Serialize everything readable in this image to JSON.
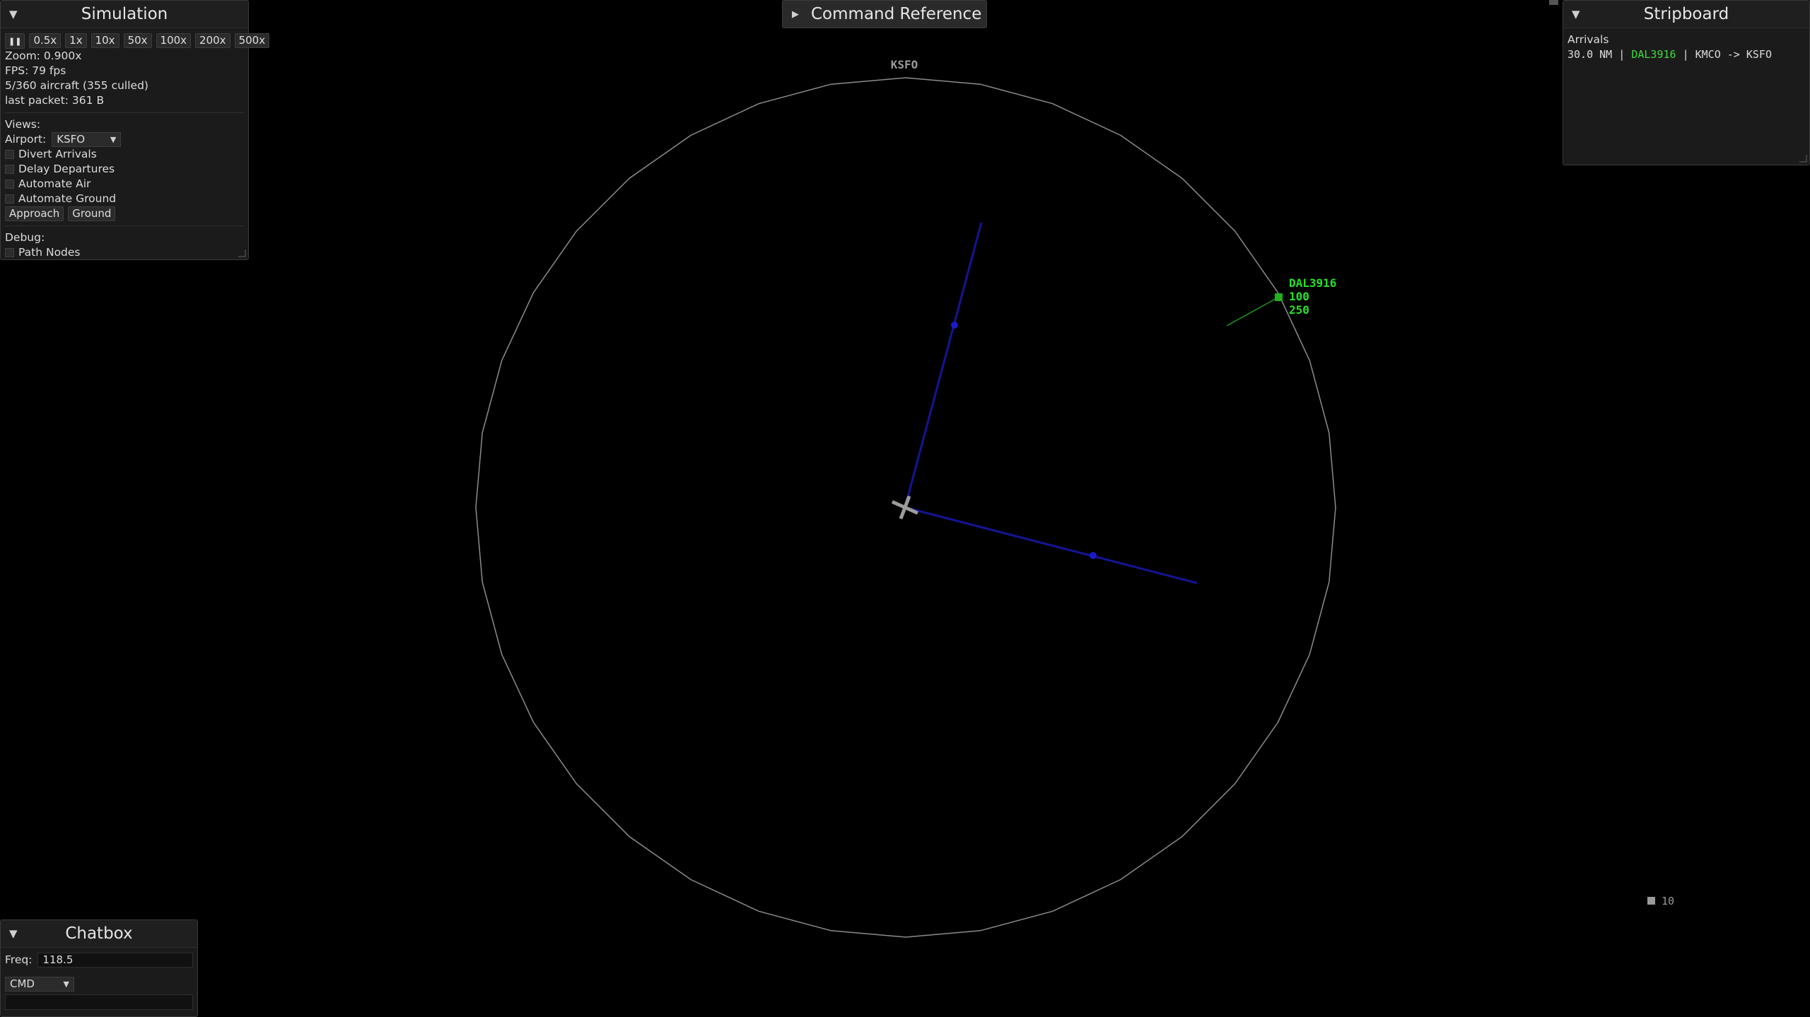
{
  "simulation": {
    "title": "Simulation",
    "speeds": [
      "0.5x",
      "1x",
      "10x",
      "50x",
      "100x",
      "200x",
      "500x"
    ],
    "zoom": "Zoom: 0.900x",
    "fps": "FPS: 79 fps",
    "aircraft": "5/360 aircraft (355 culled)",
    "last_packet": "last packet: 361 B",
    "views_label": "Views:",
    "airport_label": "Airport:",
    "airport_value": "KSFO",
    "checks": [
      "Divert Arrivals",
      "Delay Departures",
      "Automate Air",
      "Automate Ground"
    ],
    "approach_button": "Approach",
    "ground_button": "Ground",
    "debug_label": "Debug:",
    "path_nodes": "Path Nodes"
  },
  "command_reference": {
    "label": "Command Reference"
  },
  "stripboard": {
    "title": "Stripboard",
    "section": "Arrivals",
    "strip": {
      "distance": "30.0 NM",
      "callsign": "DAL3916",
      "route": "KMCO -> KSFO"
    }
  },
  "radar": {
    "airport_label": "KSFO",
    "aircraft": {
      "callsign": "DAL3916",
      "altitude": "100",
      "speed": "250"
    },
    "scale_value": "10"
  },
  "chatbox": {
    "title": "Chatbox",
    "freq_label": "Freq:",
    "freq_value": "118.5",
    "mode_value": "CMD",
    "input_value": ""
  },
  "colors": {
    "background": "#000000",
    "panel": "#1b1b1b",
    "radar_ring": "#8c8c8c",
    "approach_line": "#141496",
    "aircraft": "#27e127",
    "strip_callsign": "#3ddc3d"
  }
}
